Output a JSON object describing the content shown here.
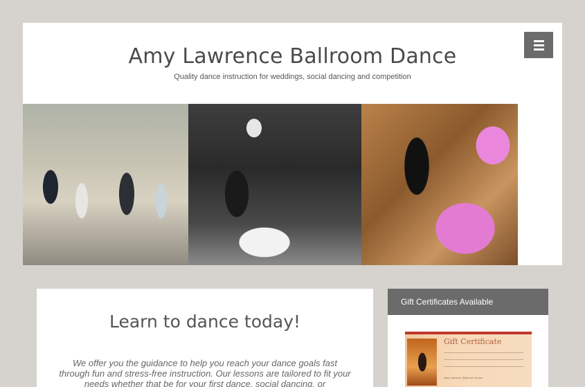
{
  "header": {
    "site_title": "Amy Lawrence Ballroom Dance",
    "tagline": "Quality dance instruction for weddings, social dancing and competition"
  },
  "main": {
    "heading": "Learn to dance today!",
    "intro_text": "We offer you the guidance to help you reach your dance goals fast through fun and stress-free instruction. Our lessons are tailored to fit your needs whether that be for your first dance, social dancing, or"
  },
  "sidebar": {
    "widget_title": "Gift Certificates Available",
    "certificate": {
      "title": "Gift Certificate",
      "footer": "Amy Lawrence Ballroom Dance"
    }
  },
  "icons": {
    "menu": "hamburger-menu-icon"
  },
  "colors": {
    "page_background": "#d6d3ce",
    "menu_button": "#6b6b6b",
    "widget_header": "#6b6b6b",
    "title_text": "#4a4a4a"
  }
}
